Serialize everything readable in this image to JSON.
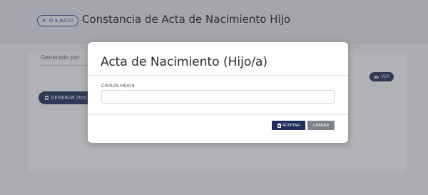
{
  "header": {
    "back_label": "IR A INICIO",
    "back_icon": "double-chevron-left-icon",
    "title": "Constancia de Acta de Nacimiento Hijo"
  },
  "form": {
    "generated_by_label": "Generado por",
    "view_button_label": "VER",
    "generate_button_label": "GENERAR DOCUMENTO"
  },
  "modal": {
    "title": "Acta de Nacimiento (Hijo/a)",
    "field_label": "Cédula Hijo/a",
    "field_value": "",
    "field_placeholder": "",
    "accept_label": "ACEPTAR",
    "close_label": "CERRAR"
  },
  "colors": {
    "primary": "#1f2d5c",
    "secondary": "#7e8389",
    "overlay": "rgba(70,72,78,0.42)"
  }
}
